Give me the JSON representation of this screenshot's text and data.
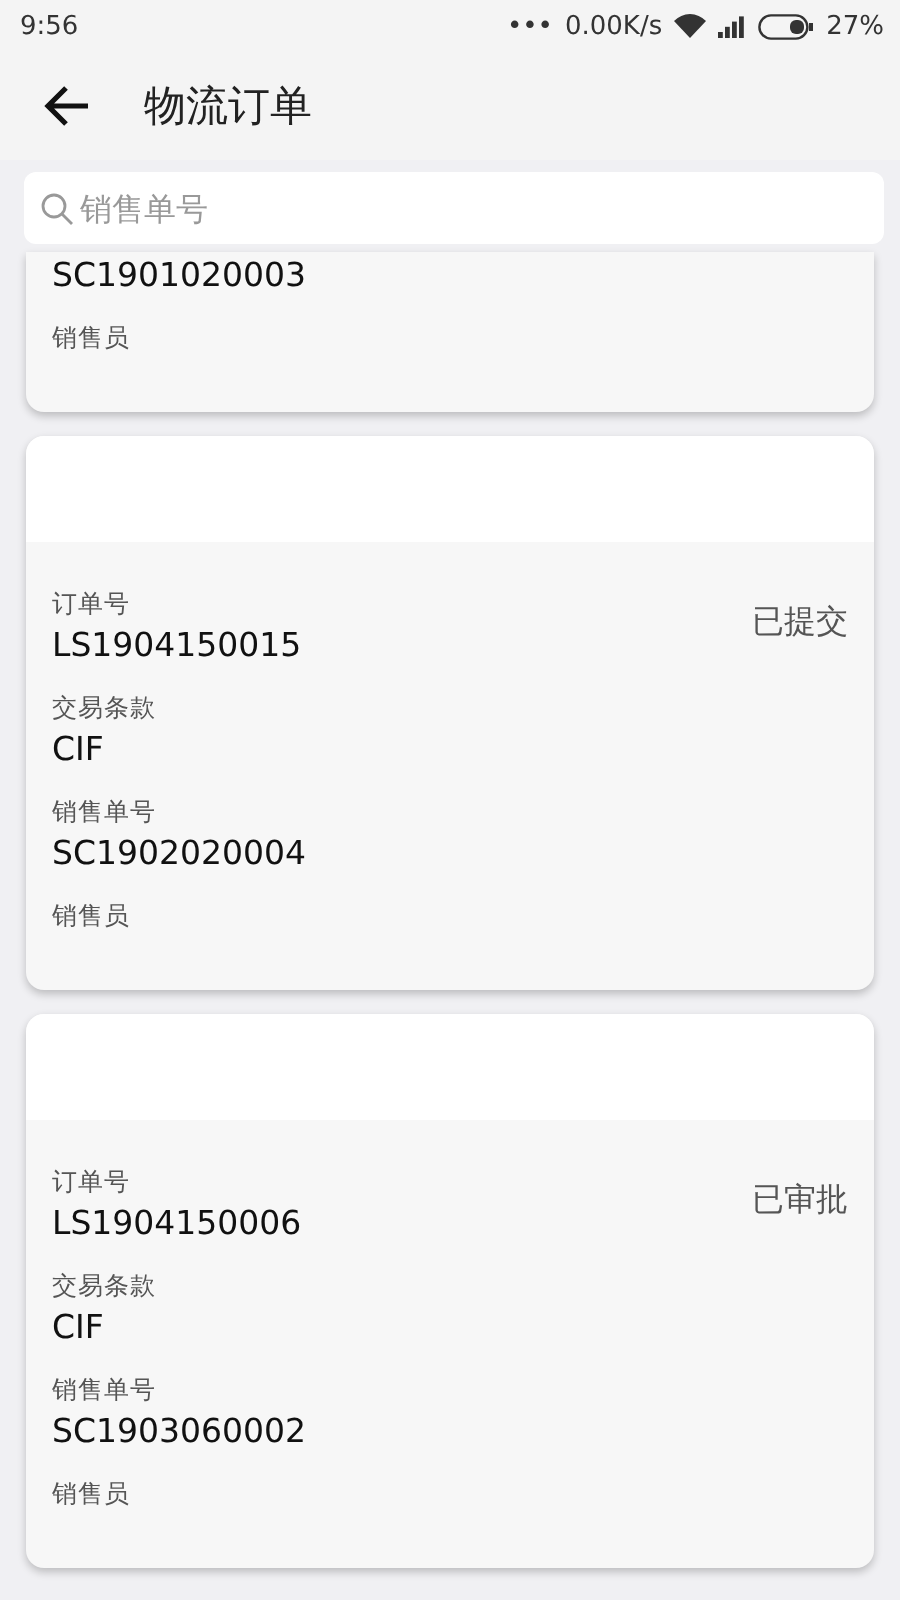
{
  "status_bar": {
    "time": "9:56",
    "dots": "•••",
    "speed": "0.00K/s",
    "battery": "27%"
  },
  "header": {
    "title": "物流订单"
  },
  "search": {
    "placeholder": "销售单号"
  },
  "orders": [
    {
      "partial": true,
      "fields": [
        {
          "value": "SC1901020003"
        },
        {
          "label": "销售员"
        }
      ]
    },
    {
      "partial": false,
      "status": "已提交",
      "fields": [
        {
          "label": "订单号",
          "value": "LS1904150015"
        },
        {
          "label": "交易条款",
          "value": "CIF"
        },
        {
          "label": "销售单号",
          "value": "SC1902020004"
        },
        {
          "label": "销售员"
        }
      ]
    },
    {
      "partial": false,
      "status": "已审批",
      "fields": [
        {
          "label": "订单号",
          "value": "LS1904150006"
        },
        {
          "label": "交易条款",
          "value": "CIF"
        },
        {
          "label": "销售单号",
          "value": "SC1903060002"
        },
        {
          "label": "销售员"
        }
      ]
    }
  ]
}
